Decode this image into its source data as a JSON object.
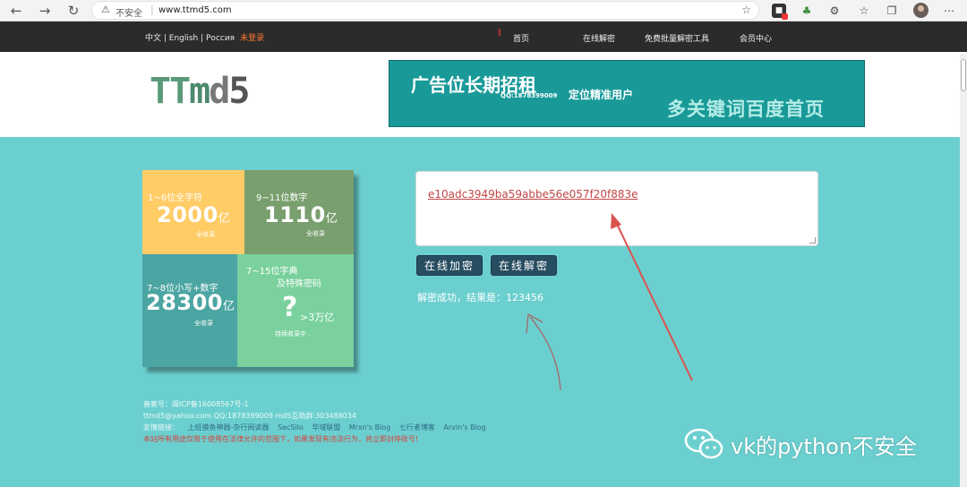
{
  "browser": {
    "security_label": "不安全",
    "url": "www.ttmd5.com"
  },
  "topnav": {
    "languages": "中文 | English | Россия",
    "login": "未登录",
    "links": [
      "首页",
      "在线解密",
      "免费批量解密工具",
      "会员中心"
    ]
  },
  "header": {
    "logo": "TTmd5",
    "ad": {
      "title": "广告位长期招租",
      "qq": "QQ:1878399009",
      "subtitle": "定位精准用户",
      "slogan": "多关键词百度首页"
    }
  },
  "stats": [
    {
      "label": "1~6位全字符",
      "number": "2000",
      "unit": "亿",
      "note": "全收录"
    },
    {
      "label": "9~11位数字",
      "number": "1110",
      "unit": "亿",
      "note": "全收录"
    },
    {
      "label": "7~8位小写+数字",
      "number": "28300",
      "unit": "亿",
      "note": "全收录"
    },
    {
      "label": "7~15位字典",
      "label2": "及特殊密码",
      "number": "?",
      "unit": ">3万亿",
      "note": "持续收录中 ."
    }
  ],
  "decrypt": {
    "input_value": "e10adc3949ba59abbe56e057f20f883e",
    "encrypt_button": "在线加密",
    "decrypt_button": "在线解密",
    "result": "解密成功，结果是：123456"
  },
  "footer": {
    "icp": "备案号：闽ICP备16008567号-1",
    "contact": "ttmd5@yahoo.com QQ:1878399009 md5互助群:303488034",
    "links_label": "友情链接：",
    "links": [
      "上班摸鱼神器-杂行阅读器",
      "SecSilo",
      "华域联盟",
      "Mrxn's Blog",
      "七行者博客",
      "Arvin's Blog"
    ],
    "warning": "本站所有用途仅限于使用在法律允许的范围下，如果发现有违法行为，将立即封停账号!"
  },
  "watermark": "vk的python不安全",
  "colors": {
    "page_bg": "#6ccfcf",
    "nav_bg": "#2b2b2b",
    "button_bg": "#274d61",
    "annotation_arrow": "#d9534f"
  }
}
